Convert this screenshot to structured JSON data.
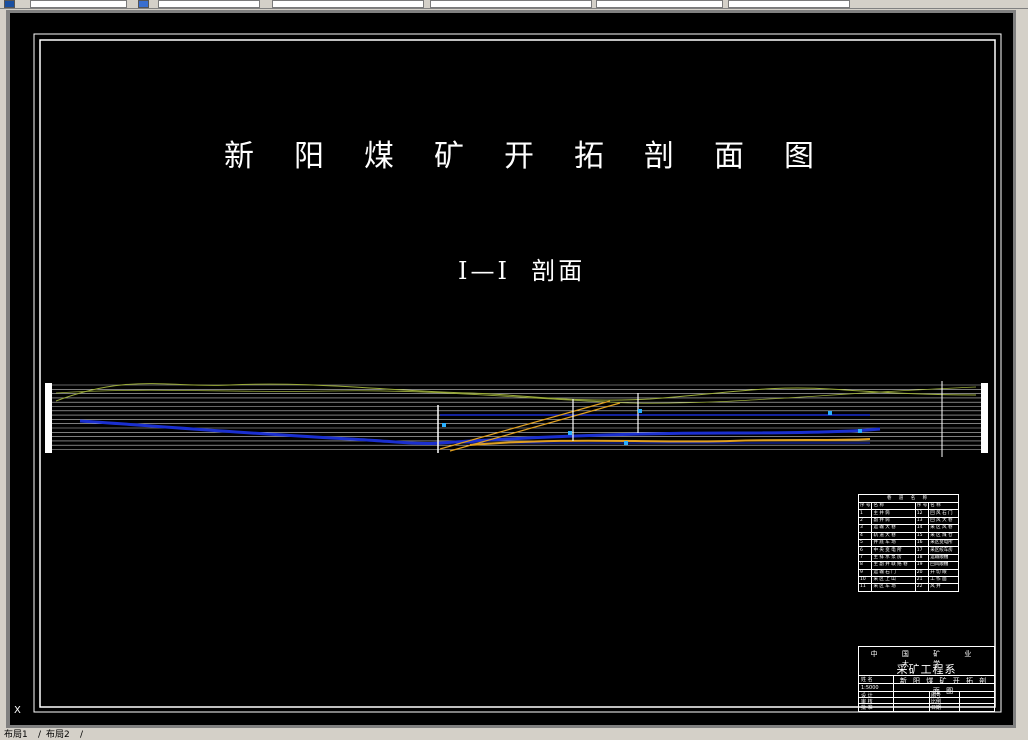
{
  "window": {
    "toolbar_icons": [
      "layer-icon",
      "properties-icon"
    ]
  },
  "drawing": {
    "title_chars": [
      "新",
      "阳",
      "煤",
      "矿",
      "开",
      "拓",
      "剖",
      "面",
      "图"
    ],
    "section_label": "I—I  剖面",
    "ucs_label": "X",
    "colors": {
      "background": "#000000",
      "frame": "#ffffff",
      "terrain": "#9aab3a",
      "seam": "#1a2fd0",
      "roadway": "#e0a020",
      "strata": "#c8c8c8"
    }
  },
  "legend": {
    "title": "巷 道 名 称",
    "headers": [
      "序 号",
      "名 称",
      "序 号",
      "名 称"
    ],
    "rows": [
      [
        "1",
        "主 井 筒",
        "12",
        "回 风 石 门"
      ],
      [
        "2",
        "副 井 筒",
        "13",
        "回 风 大 巷"
      ],
      [
        "3",
        "运 输 大 巷",
        "14",
        "采 区 风 巷"
      ],
      [
        "4",
        "轨 道 大 巷",
        "15",
        "采 区 煤 仓"
      ],
      [
        "5",
        "井 底 车 场",
        "16",
        "采区变电所"
      ],
      [
        "6",
        "中 央 变 电 所",
        "17",
        "采区绞车房"
      ],
      [
        "7",
        "主 排 水 泵 房",
        "18",
        "运输顺槽"
      ],
      [
        "8",
        "主 副 井 联 络 巷",
        "19",
        "回风顺槽"
      ],
      [
        "9",
        "运 输 石 门",
        "20",
        "开 切 眼"
      ],
      [
        "10",
        "采 区 上 山",
        "21",
        "工 作 面"
      ],
      [
        "11",
        "采 区 车 场",
        "22",
        "风 井"
      ]
    ]
  },
  "title_block": {
    "university": "中 国 矿 业 大 学",
    "department": "采矿工程系",
    "left_labels": [
      "姓 名",
      "1:5000",
      "设 计",
      "审 核",
      "批 准"
    ],
    "drawing_name": "新 阳 煤 矿 开 拓 剖 面 图",
    "right_labels": [
      "图号",
      "比例",
      "日期"
    ]
  },
  "layout_tabs": [
    "布局1",
    "布局2"
  ]
}
